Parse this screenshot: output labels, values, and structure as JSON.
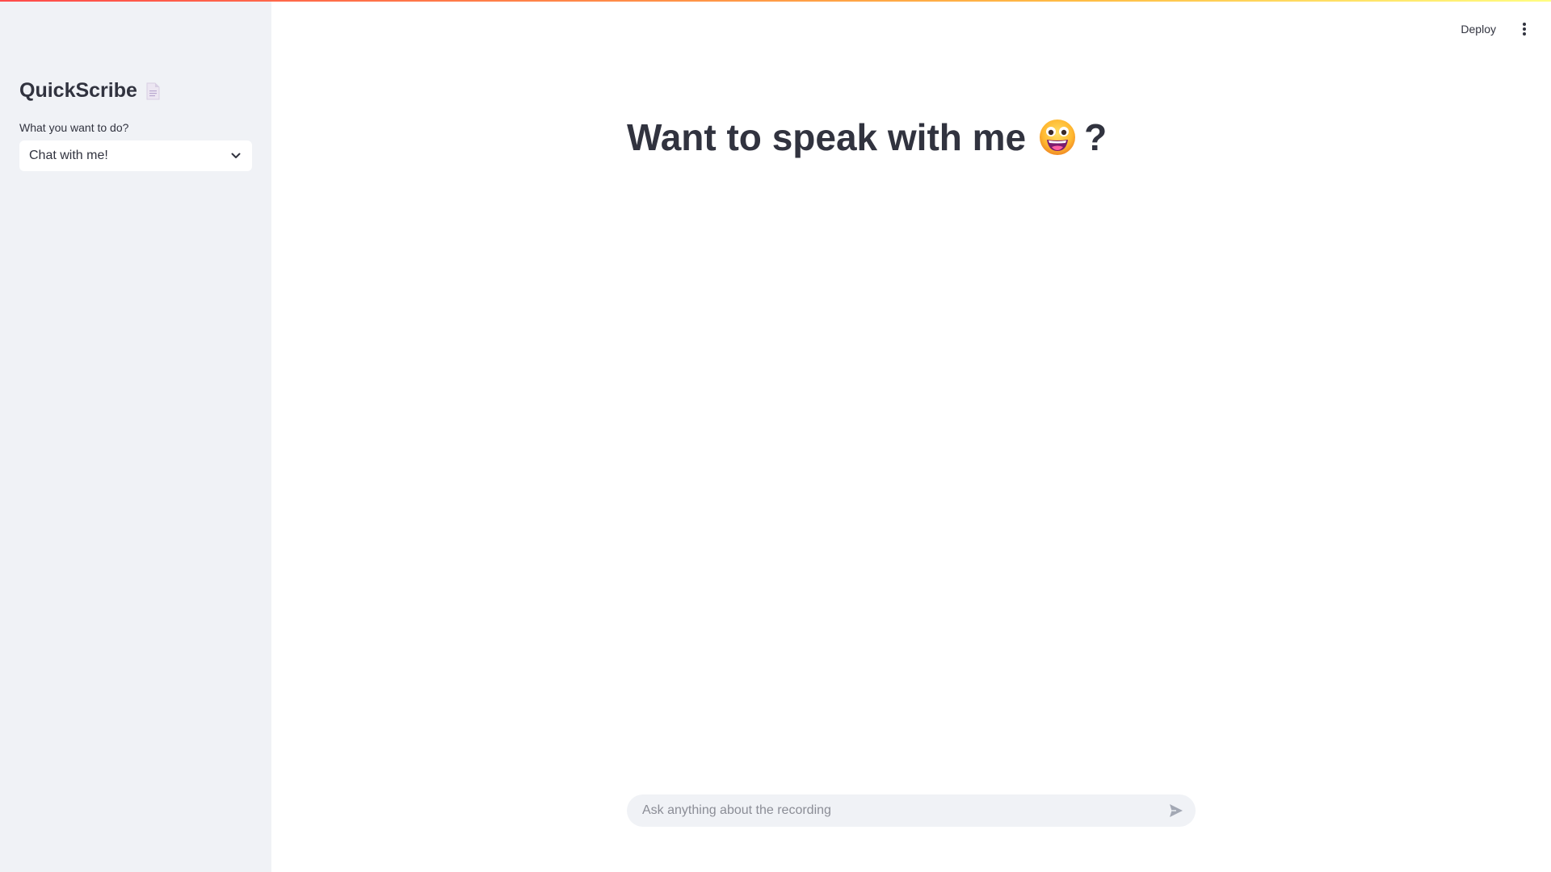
{
  "sidebar": {
    "title": "QuickScribe",
    "title_icon": "document-icon",
    "select": {
      "label": "What you want to do?",
      "value": "Chat with me!"
    }
  },
  "header": {
    "deploy_label": "Deploy",
    "menu_icon": "kebab-menu-icon"
  },
  "main": {
    "heading_before": "Want to speak with me",
    "heading_emoji": "grinning-face-emoji",
    "heading_after": "?"
  },
  "chat": {
    "placeholder": "Ask anything about the recording",
    "value": "",
    "send_icon": "send-icon"
  },
  "colors": {
    "sidebar_bg": "#f0f2f6",
    "text": "#31333f",
    "accent_gradient_start": "#ff4b4b",
    "accent_gradient_end": "#fffd80"
  }
}
